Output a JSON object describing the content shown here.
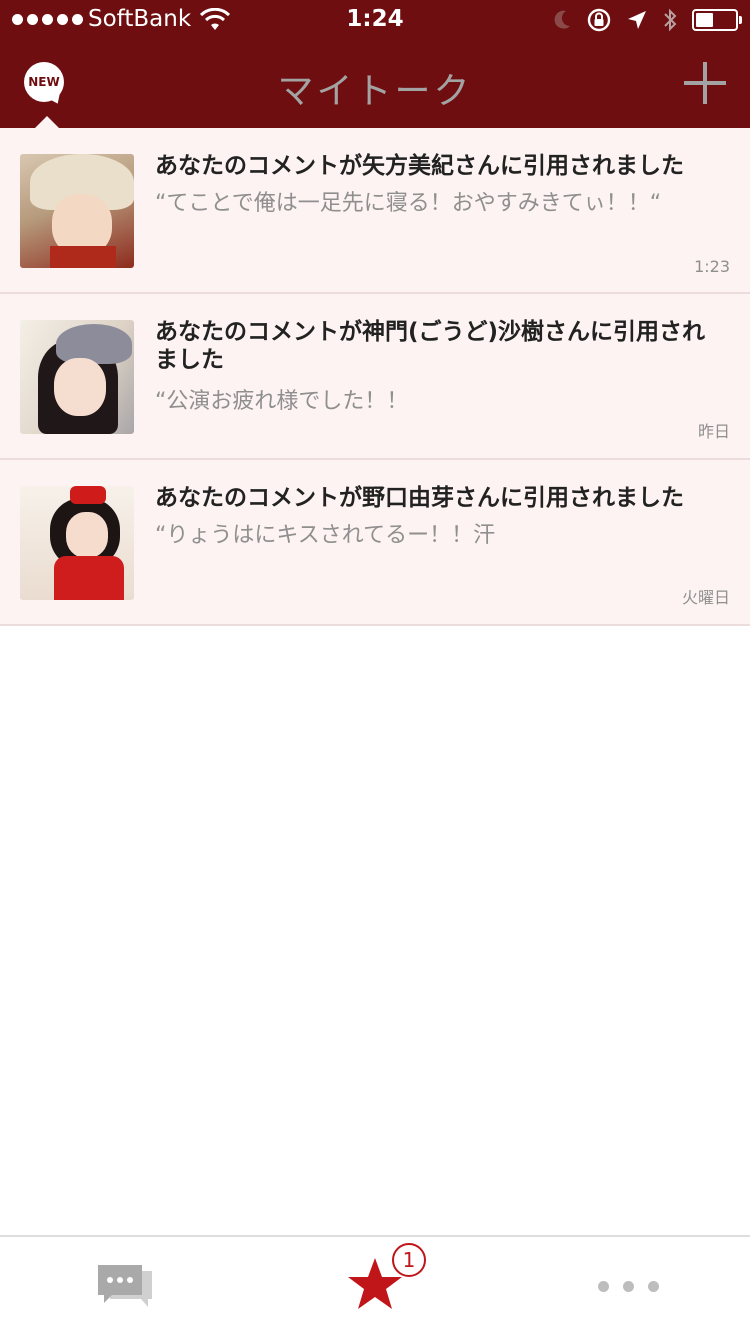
{
  "status_bar": {
    "carrier": "SoftBank",
    "time": "1:24",
    "battery_level": 0.45
  },
  "nav": {
    "title": "マイトーク",
    "new_badge": "NEW"
  },
  "colors": {
    "header_bg": "#6f0e10",
    "row_bg": "#fdf3f2",
    "accent_red": "#c0161a"
  },
  "notifications": [
    {
      "title": "あなたのコメントが矢方美紀さんに引用されました",
      "quote": "“てことで俺は一足先に寝る！おやすみきてぃ！！“",
      "time": "1:23"
    },
    {
      "title": "あなたのコメントが神門(ごうど)沙樹さんに引用されました",
      "quote": "“公演お疲れ様でした！！",
      "time": "昨日"
    },
    {
      "title": "あなたのコメントが野口由芽さんに引用されました",
      "quote": "“りょうはにキスされてるー！！汗",
      "time": "火曜日"
    }
  ],
  "tabbar": {
    "items": [
      {
        "icon": "chat-bubbles-icon"
      },
      {
        "icon": "star-icon",
        "badge": "1"
      },
      {
        "icon": "more-dots-icon"
      }
    ]
  }
}
